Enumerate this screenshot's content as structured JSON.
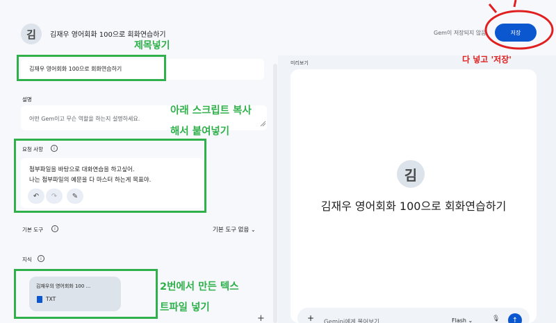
{
  "header": {
    "avatar_letter": "김",
    "title": "김재우 영어회화 100으로 회화연습하기",
    "unsaved_text": "Gem이 저장되지 않음",
    "save_label": "저장"
  },
  "form": {
    "name_value": "김재우 영어회화 100으로 회화연습하기",
    "description_label": "설명",
    "description_placeholder": "어떤 Gem이고 무슨 역할을 하는지 설명하세요.",
    "instructions_label": "요청 사항",
    "instructions_lines": [
      "첨부파일을 바탕으로 대화연습을 하고싶어.",
      "나는 첨부파일의 예문을 다 마스터 하는게 목표야."
    ],
    "default_tools_label": "기본 도구",
    "default_tools_value": "기본 도구 없음",
    "knowledge_label": "지식",
    "file": {
      "name": "김재우의 영어회화 100 ...",
      "type": "TXT"
    }
  },
  "preview": {
    "label": "미리보기",
    "avatar_letter": "김",
    "title": "김재우 영어회화 100으로 회화연습하기",
    "chat_placeholder": "Gemini에게 물어보기",
    "model": "Flash"
  },
  "annotations": {
    "name_note": "제목넣기",
    "script_note_1": "아래 스크립트 복사",
    "script_note_2": "해서 붙여넣기",
    "file_note_1": "2번에서 만든 텍스",
    "file_note_2": "트파일 넣기",
    "save_note": "다 넣고 '저장'"
  },
  "icons": [
    "info-icon",
    "undo-icon",
    "redo-icon",
    "magic-wand-icon",
    "file-icon",
    "chevron-down-icon",
    "plus-icon",
    "mic-icon",
    "send-icon"
  ],
  "colors": {
    "accent": "#0b57d0",
    "annotation_green": "#2fb04a",
    "annotation_red": "#e02020"
  }
}
